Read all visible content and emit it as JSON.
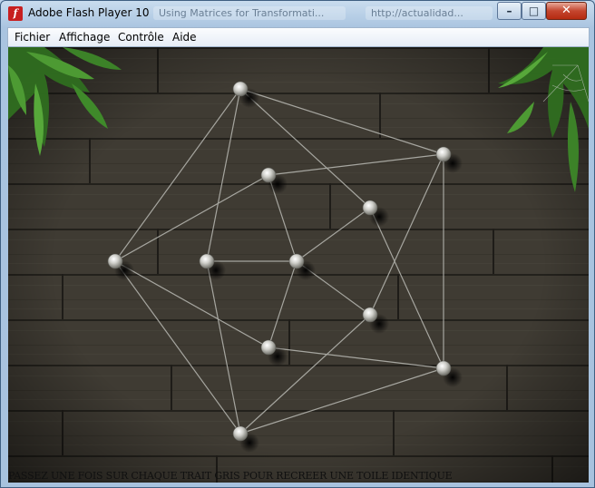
{
  "window": {
    "title": "Adobe Flash Player 10",
    "icon": "flash-player-icon",
    "background_tabs": [
      "Using Matrices for Transformati...",
      "http://actualidad..."
    ],
    "controls": {
      "minimize": "–",
      "maximize": "□",
      "close": "✕"
    }
  },
  "menu": {
    "items": [
      "Fichier",
      "Affichage",
      "Contrôle",
      "Aide"
    ]
  },
  "game": {
    "instruction": "PASSEZ UNE FOIS SUR CHAQUE TRAIT GRIS POUR RECREER UNE TOILE IDENTIQUE",
    "pins": [
      {
        "id": "p1"
      },
      {
        "id": "p2"
      },
      {
        "id": "p3"
      },
      {
        "id": "p4"
      },
      {
        "id": "p5"
      },
      {
        "id": "p6"
      },
      {
        "id": "p7"
      },
      {
        "id": "p8"
      },
      {
        "id": "p9"
      },
      {
        "id": "p10"
      },
      {
        "id": "p11"
      },
      {
        "id": "p12"
      }
    ],
    "colors": {
      "wood": "#3d3a32",
      "thread": "#b9b9b3",
      "leaf": "#3f8a2a"
    }
  }
}
